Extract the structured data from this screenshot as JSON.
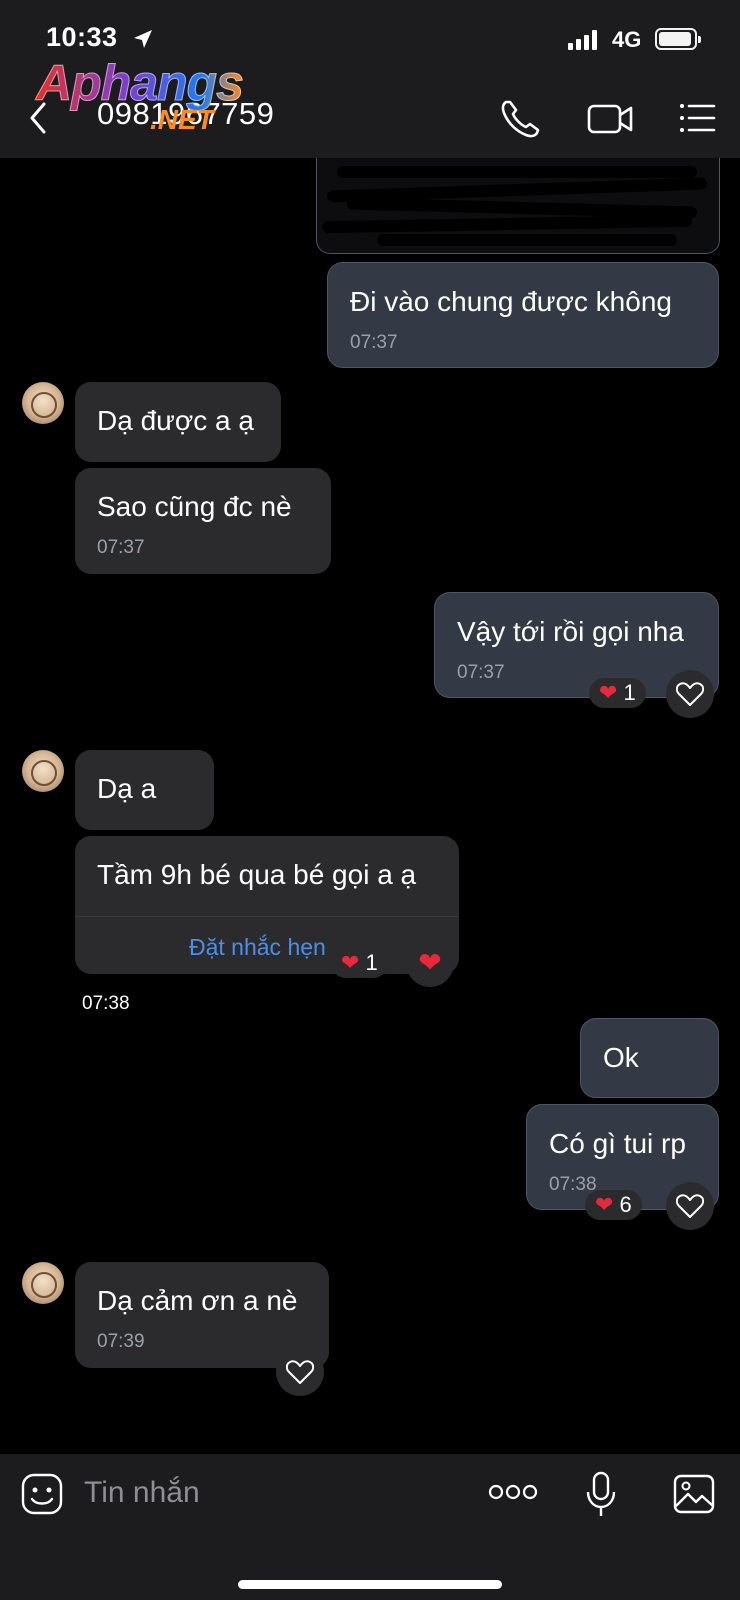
{
  "status_bar": {
    "time": "10:33",
    "network": "4G"
  },
  "header": {
    "contact": "0981967759",
    "watermark_main": "Aphangs",
    "watermark_sub": ".NET"
  },
  "messages": [
    {
      "text": "Đi vào chung được không",
      "time": "07:37"
    },
    {
      "text": "Dạ được a ạ"
    },
    {
      "text": "Sao cũng đc nè",
      "time": "07:37"
    },
    {
      "text": "Vậy tới rồi gọi nha",
      "time": "07:37",
      "reaction_count": "1"
    },
    {
      "text": "Dạ a"
    },
    {
      "text": "Tầm 9h bé qua bé gọi a ạ",
      "action": "Đặt nhắc hẹn",
      "time": "07:38",
      "reaction_count": "1"
    },
    {
      "text": "Ok"
    },
    {
      "text": "Có gì tui rp",
      "time": "07:38",
      "reaction_count": "6"
    },
    {
      "text": "Dạ cảm ơn a nè",
      "time": "07:39"
    }
  ],
  "input": {
    "placeholder": "Tin nhắn"
  },
  "icons": {
    "back": "chevron-left-icon",
    "call": "phone-icon",
    "video": "video-icon",
    "menu": "list-icon",
    "sticker": "sticker-icon",
    "more": "more-icon",
    "mic": "microphone-icon",
    "image": "image-icon"
  },
  "colors": {
    "outgoing_bubble": "#333a45",
    "incoming_bubble": "#2b2b2d",
    "heart": "#e8283c",
    "link": "#4b8fe6"
  }
}
